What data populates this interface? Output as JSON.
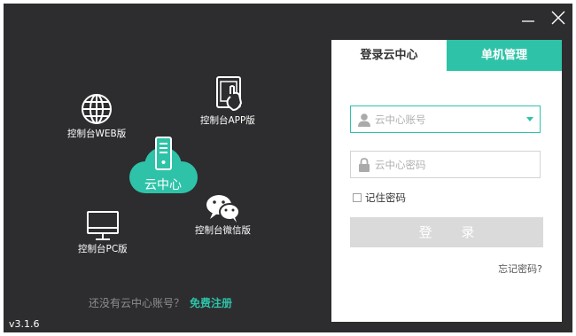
{
  "window": {
    "icons": {
      "minimize": "minimize-icon",
      "close": "close-icon"
    }
  },
  "features": [
    {
      "label": "控制台WEB版",
      "icon": "globe-icon"
    },
    {
      "label": "控制台APP版",
      "icon": "tablet-touch-icon"
    },
    {
      "label": "控制台微信版",
      "icon": "wechat-icon"
    },
    {
      "label": "控制台PC版",
      "icon": "monitor-icon"
    }
  ],
  "cloud": {
    "label": "云中心",
    "icon": "server-cloud-icon"
  },
  "footer": {
    "prompt": "还没有云中心账号？",
    "register": "免费注册"
  },
  "version": "v3.1.6",
  "panel": {
    "tabs": [
      {
        "label": "登录云中心",
        "active": true
      },
      {
        "label": "单机管理",
        "active": false
      }
    ],
    "account": {
      "placeholder": "云中心账号",
      "value": ""
    },
    "password": {
      "placeholder": "云中心密码",
      "value": ""
    },
    "remember_label": "记住密码",
    "remember_checked": false,
    "login_label": "登 录",
    "forgot_label": "忘记密码?"
  },
  "colors": {
    "background": "#2d2d2f",
    "accent": "#2ec3a8",
    "button_disabled": "#dadada"
  }
}
